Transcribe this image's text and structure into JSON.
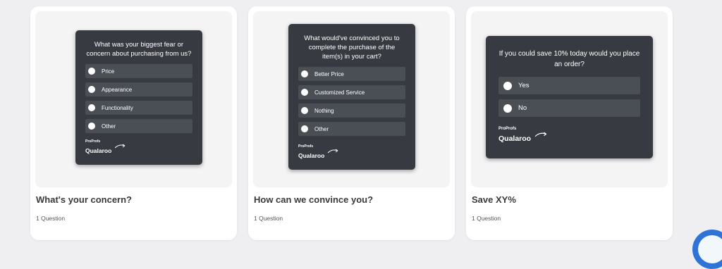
{
  "cards": [
    {
      "question": "What was your biggest fear or concern about purchasing from us?",
      "options": [
        "Price",
        "Appearance",
        "Functionality",
        "Other"
      ],
      "title": "What's your concern?",
      "subtitle": "1 Question"
    },
    {
      "question": "What would've convinced you to complete the purchase of the item(s) in your cart?",
      "options": [
        "Better Price",
        "Customized Service",
        "Nothing",
        "Other"
      ],
      "title": "How can we convince you?",
      "subtitle": "1 Question"
    },
    {
      "question": "If you could save 10% today would you place an order?",
      "options": [
        "Yes",
        "No"
      ],
      "title": "Save XY%",
      "subtitle": "1 Question"
    }
  ],
  "brand": {
    "top": "ProProfs",
    "main": "Qualaroo"
  },
  "colors": {
    "survey_bg": "#373a40",
    "option_bg": "#4a4e55",
    "fab": "#2e74d8"
  },
  "fab_icon": "chat-widget-icon"
}
